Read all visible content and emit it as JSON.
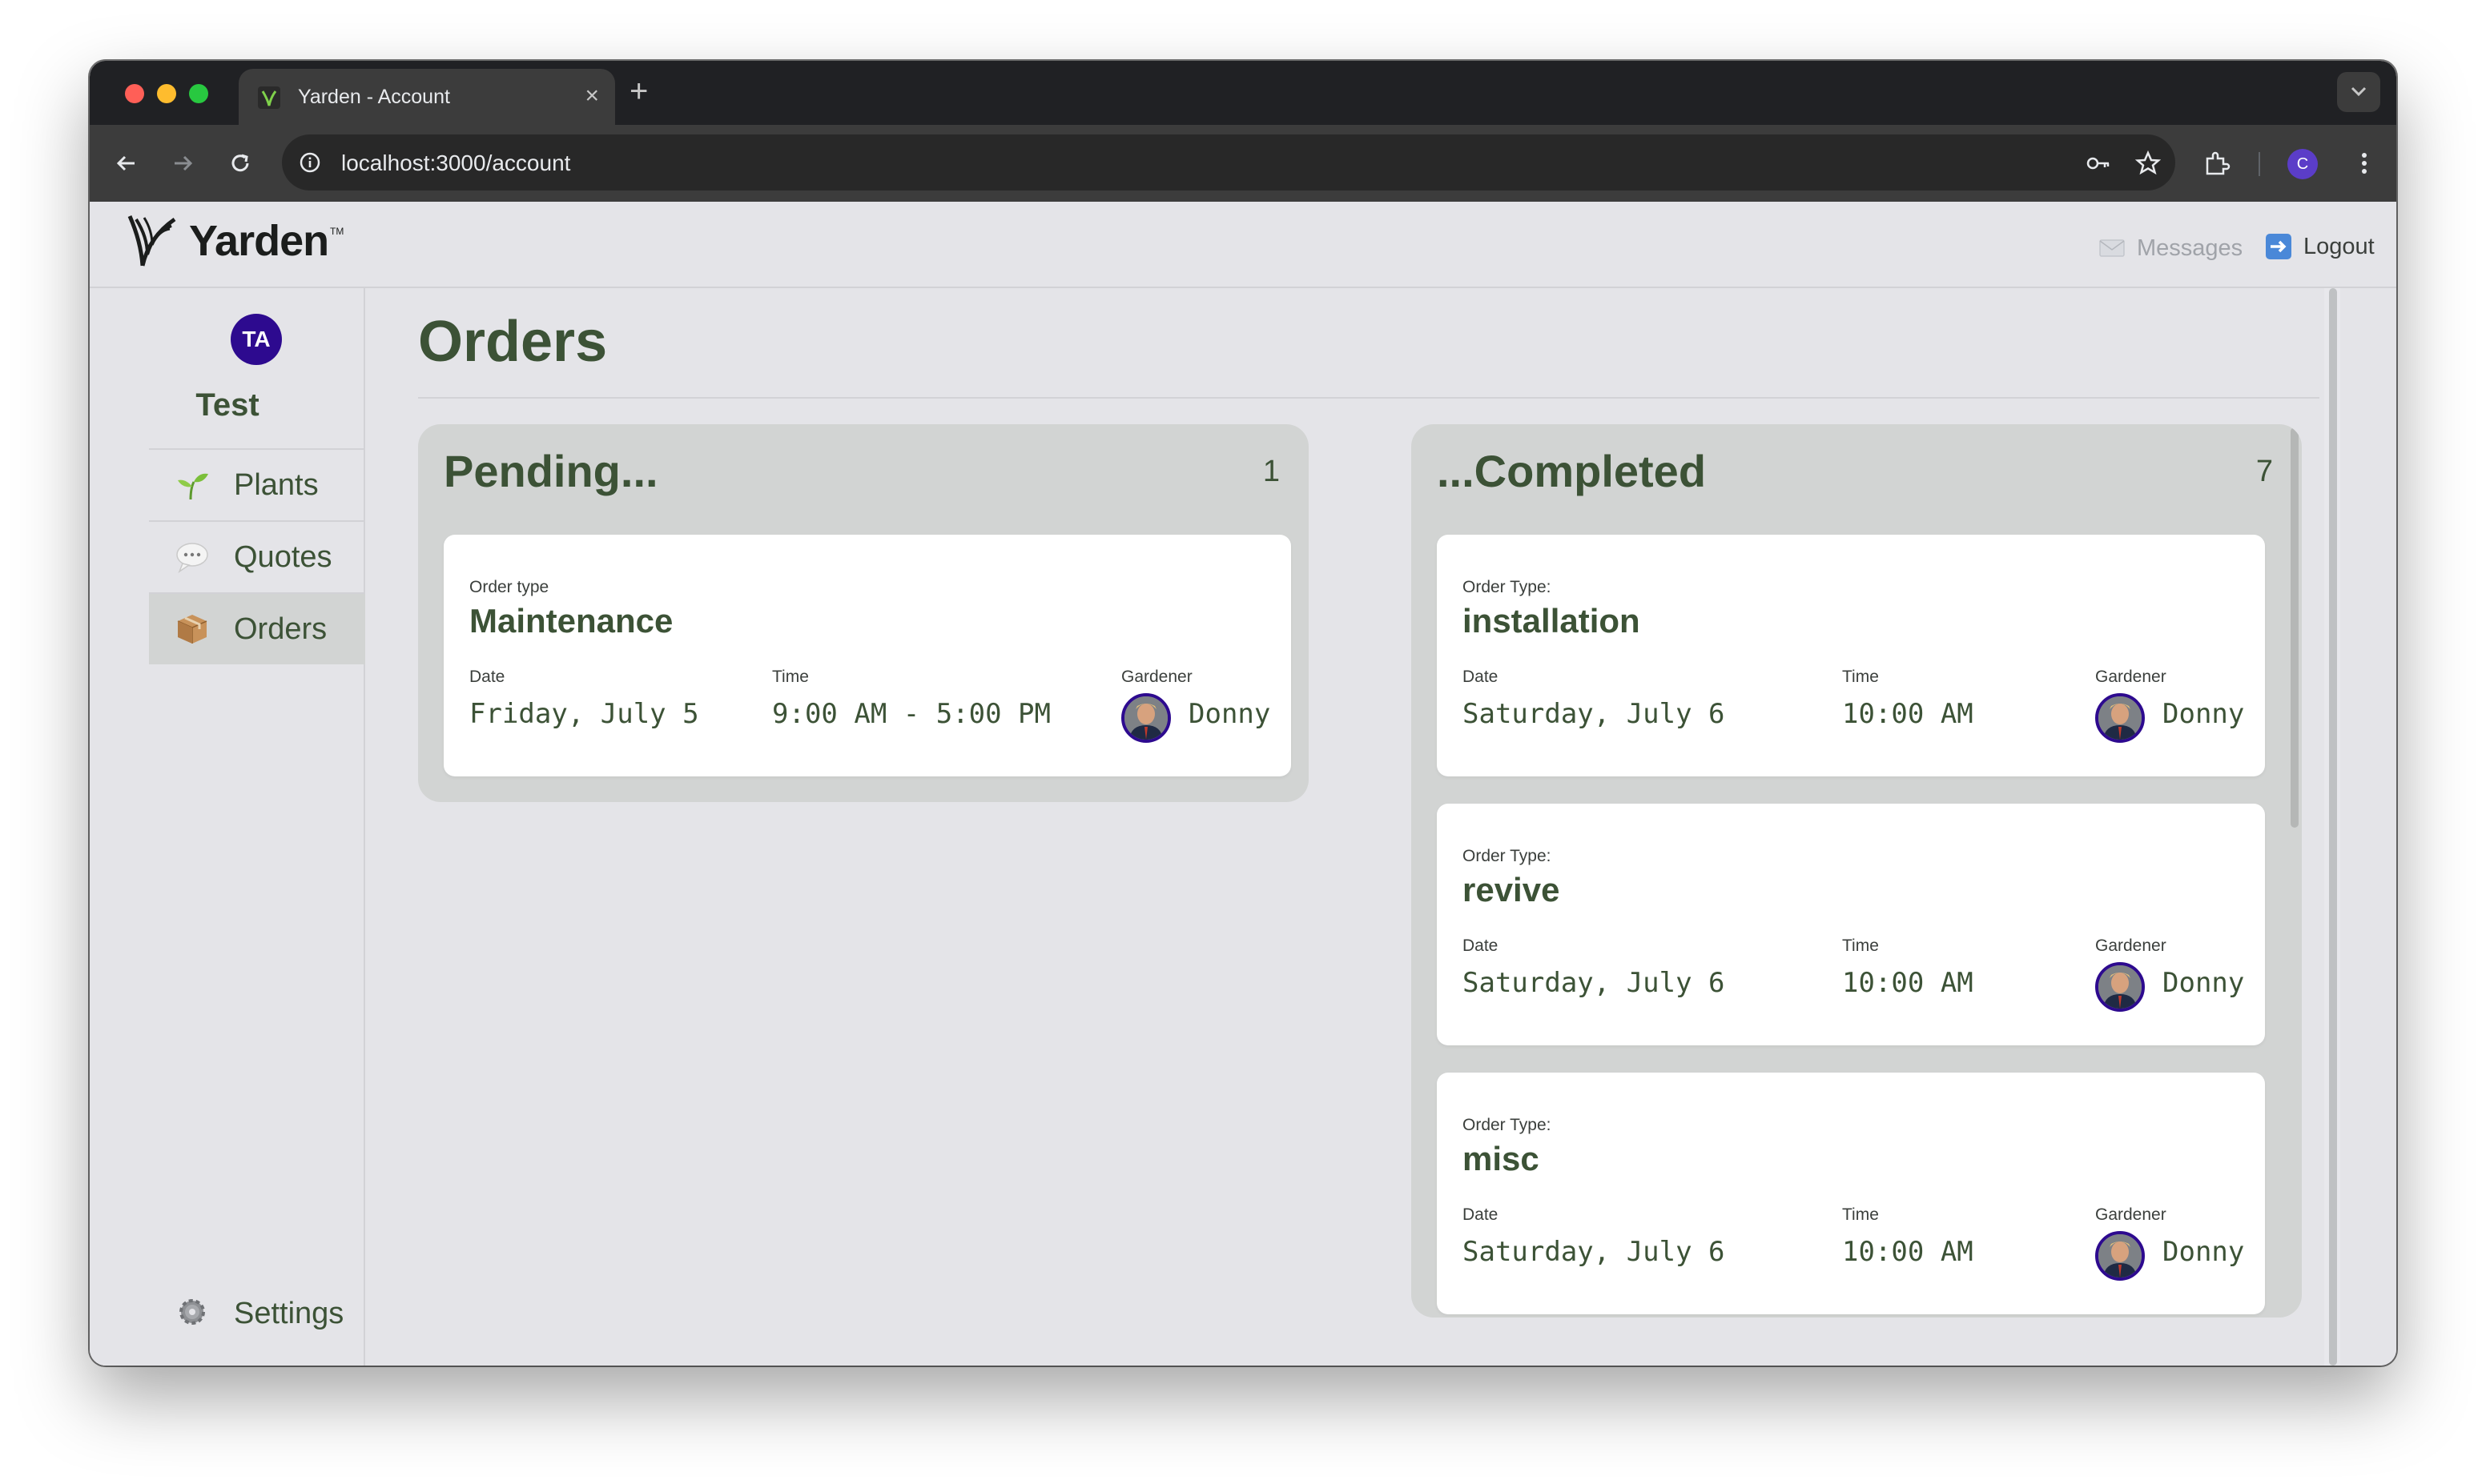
{
  "browser": {
    "tab_title": "Yarden - Account",
    "tab_close": "×",
    "new_tab": "+",
    "url": "localhost:3000/account",
    "profile_initial": "C"
  },
  "header": {
    "logo_text": "Yarden",
    "logo_tm": "TM",
    "messages_label": "Messages",
    "logout_label": "Logout"
  },
  "sidebar": {
    "user_initials": "TA",
    "user_name": "Test",
    "items": [
      {
        "label": "Plants",
        "icon": "seedling-icon"
      },
      {
        "label": "Quotes",
        "icon": "speech-bubble-icon"
      },
      {
        "label": "Orders",
        "icon": "package-icon",
        "active": true
      }
    ],
    "settings_label": "Settings"
  },
  "main": {
    "title": "Orders",
    "pending": {
      "heading": "Pending...",
      "count": "1",
      "orders": [
        {
          "type_label": "Order type",
          "type": "Maintenance",
          "date_label": "Date",
          "date": "Friday, July 5",
          "time_label": "Time",
          "time": "9:00 AM - 5:00 PM",
          "gardener_label": "Gardener",
          "gardener": "Donny"
        }
      ]
    },
    "completed": {
      "heading": "...Completed",
      "count": "7",
      "orders": [
        {
          "type_label": "Order Type:",
          "type": "installation",
          "date_label": "Date",
          "date": "Saturday, July 6",
          "time_label": "Time",
          "time": "10:00 AM",
          "gardener_label": "Gardener",
          "gardener": "Donny"
        },
        {
          "type_label": "Order Type:",
          "type": "revive",
          "date_label": "Date",
          "date": "Saturday, July 6",
          "time_label": "Time",
          "time": "10:00 AM",
          "gardener_label": "Gardener",
          "gardener": "Donny"
        },
        {
          "type_label": "Order Type:",
          "type": "misc",
          "date_label": "Date",
          "date": "Saturday, July 6",
          "time_label": "Time",
          "time": "10:00 AM",
          "gardener_label": "Gardener",
          "gardener": "Donny"
        }
      ]
    }
  },
  "colors": {
    "brand_green": "#3c5236",
    "avatar_purple": "#2d0a8f",
    "panel_bg": "#d2d4d3",
    "page_bg": "#e4e4e8"
  }
}
